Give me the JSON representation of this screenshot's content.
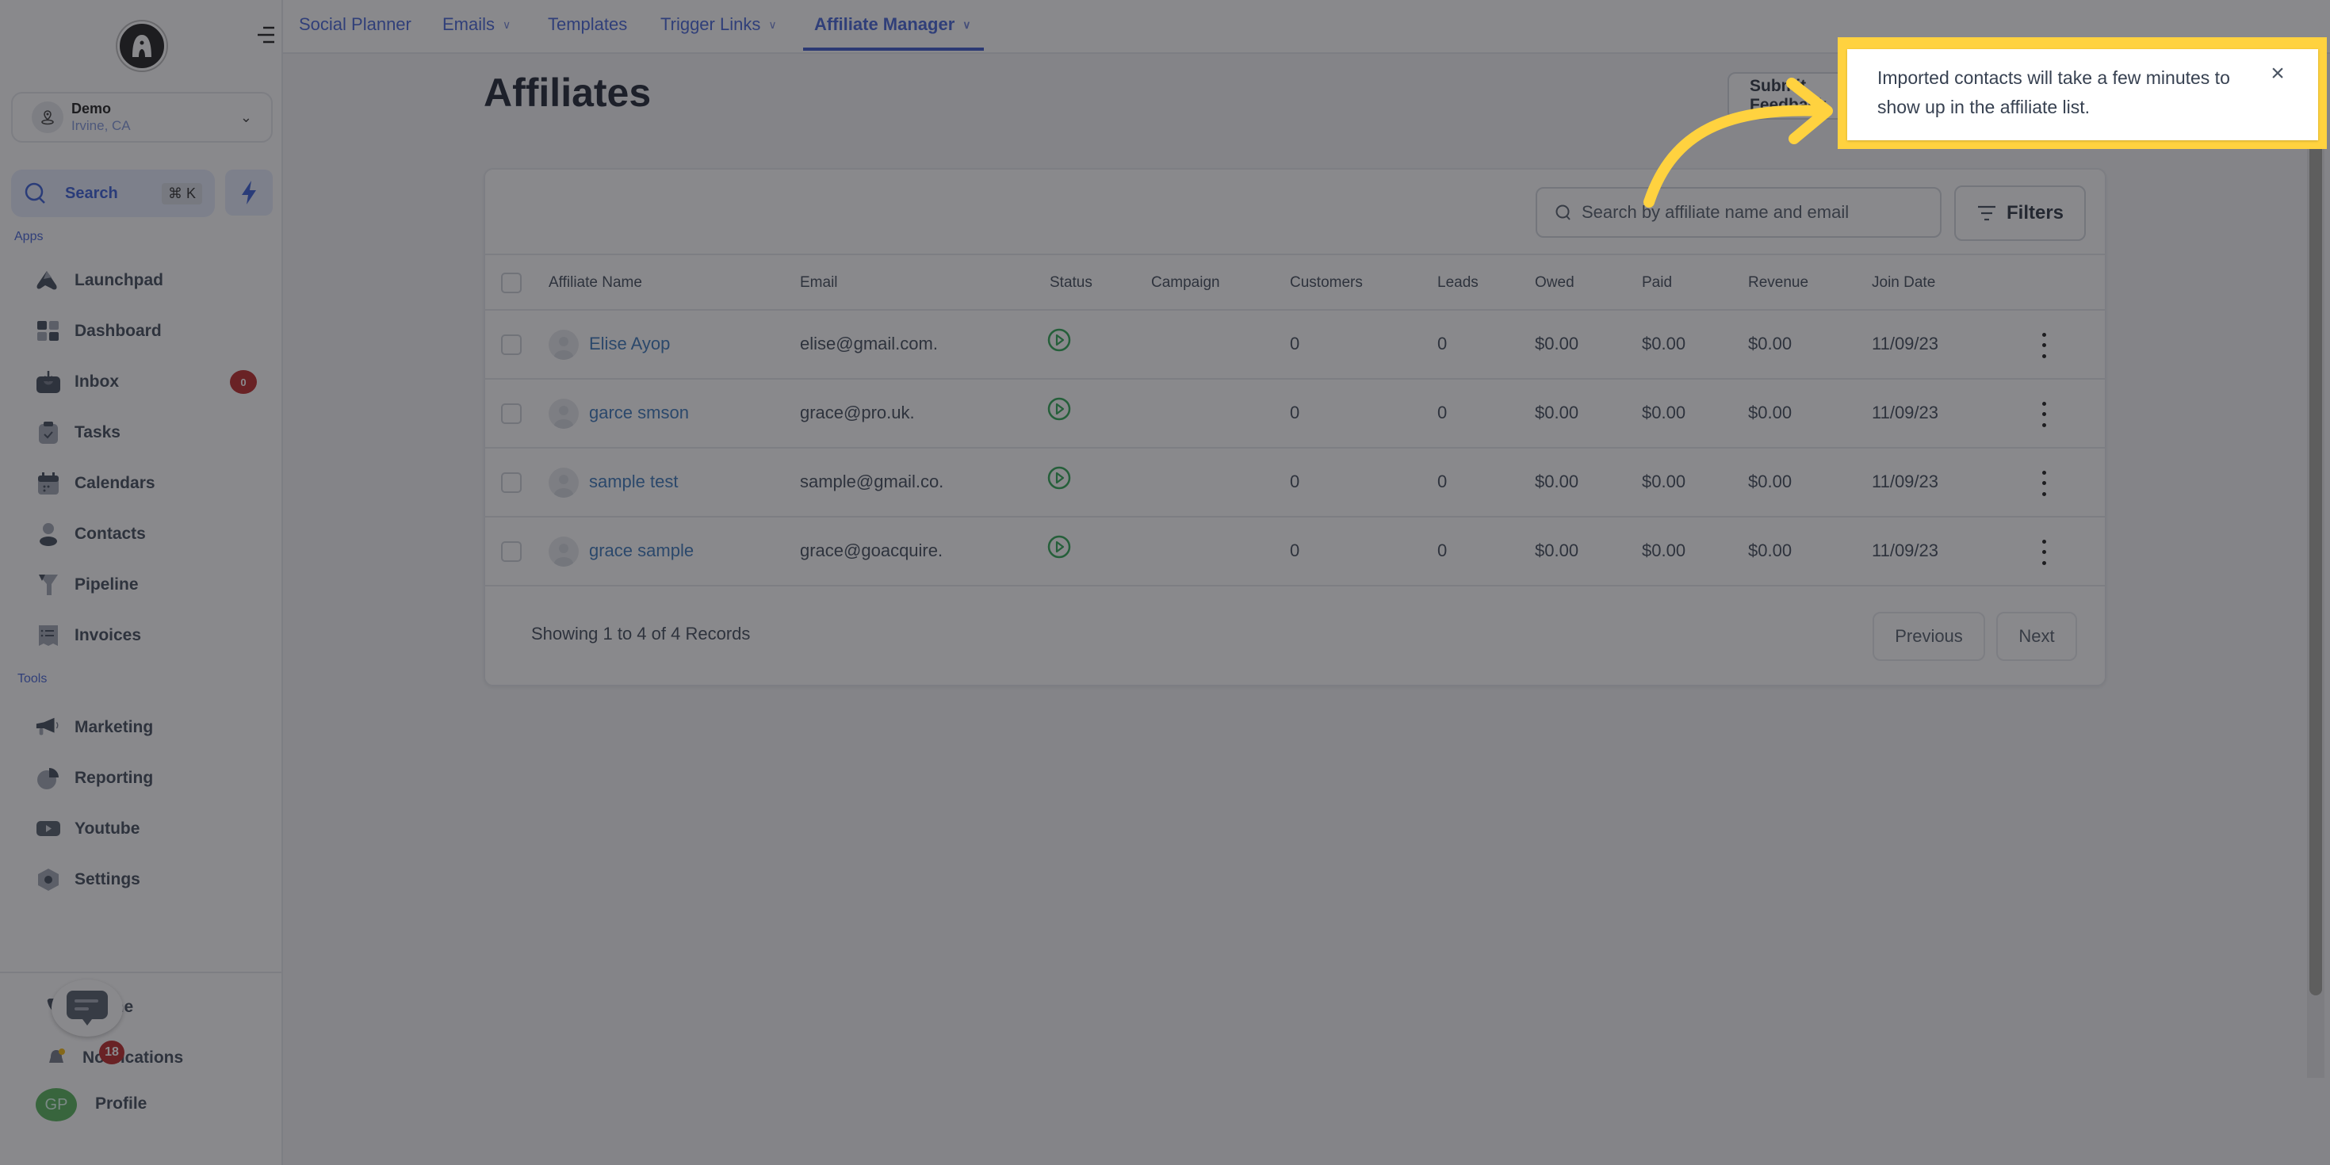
{
  "sidebar": {
    "account": {
      "name": "Demo",
      "location": "Irvine, CA"
    },
    "search": {
      "label": "Search",
      "shortcut": "⌘ K"
    },
    "apps_label": "Apps",
    "tools_label": "Tools",
    "apps": [
      {
        "label": "Launchpad",
        "icon": "launchpad-icon"
      },
      {
        "label": "Dashboard",
        "icon": "dashboard-icon"
      },
      {
        "label": "Inbox",
        "icon": "inbox-icon",
        "badge": "0"
      },
      {
        "label": "Tasks",
        "icon": "tasks-icon"
      },
      {
        "label": "Calendars",
        "icon": "calendar-icon"
      },
      {
        "label": "Contacts",
        "icon": "contacts-icon"
      },
      {
        "label": "Pipeline",
        "icon": "pipeline-icon"
      },
      {
        "label": "Invoices",
        "icon": "invoices-icon"
      }
    ],
    "tools": [
      {
        "label": "Marketing",
        "icon": "megaphone-icon"
      },
      {
        "label": "Reporting",
        "icon": "reporting-icon"
      },
      {
        "label": "Youtube",
        "icon": "youtube-icon"
      },
      {
        "label": "Settings",
        "icon": "settings-icon"
      }
    ],
    "bottom": [
      {
        "label": "Phone",
        "icon": "phone-icon"
      },
      {
        "label": "Notifications",
        "icon": "bell-icon"
      },
      {
        "label": "Profile",
        "icon": "avatar"
      }
    ],
    "profile_initials": "GP",
    "chat_badge": "18"
  },
  "topnav": {
    "tabs": [
      {
        "label": "Social Planner",
        "dropdown": false
      },
      {
        "label": "Emails",
        "dropdown": true
      },
      {
        "label": "Templates",
        "dropdown": false
      },
      {
        "label": "Trigger Links",
        "dropdown": true
      },
      {
        "label": "Affiliate Manager",
        "dropdown": true,
        "active": true
      }
    ]
  },
  "main": {
    "title": "Affiliates",
    "submit_feedback_label": "Submit Feedback",
    "search_placeholder": "Search by affiliate name and email",
    "filters_label": "Filters",
    "columns": [
      "Affiliate Name",
      "Email",
      "Status",
      "Campaign",
      "Customers",
      "Leads",
      "Owed",
      "Paid",
      "Revenue",
      "Join Date"
    ],
    "rows": [
      {
        "name": "Elise Ayop",
        "email": "elise@gmail.com.",
        "status": "active",
        "campaign": "",
        "customers": "0",
        "leads": "0",
        "owed": "$0.00",
        "paid": "$0.00",
        "revenue": "$0.00",
        "join_date": "11/09/23"
      },
      {
        "name": "garce smson",
        "email": "grace@pro.uk.",
        "status": "active",
        "campaign": "",
        "customers": "0",
        "leads": "0",
        "owed": "$0.00",
        "paid": "$0.00",
        "revenue": "$0.00",
        "join_date": "11/09/23"
      },
      {
        "name": "sample test",
        "email": "sample@gmail.co.",
        "status": "active",
        "campaign": "",
        "customers": "0",
        "leads": "0",
        "owed": "$0.00",
        "paid": "$0.00",
        "revenue": "$0.00",
        "join_date": "11/09/23"
      },
      {
        "name": "grace sample",
        "email": "grace@goacquire.",
        "status": "active",
        "campaign": "",
        "customers": "0",
        "leads": "0",
        "owed": "$0.00",
        "paid": "$0.00",
        "revenue": "$0.00",
        "join_date": "11/09/23"
      }
    ],
    "showing_text": "Showing 1 to 4 of 4 Records",
    "previous_label": "Previous",
    "next_label": "Next"
  },
  "toast": {
    "message": "Imported contacts will take a few minutes to show up in the affiliate list.",
    "close_label": "×"
  },
  "colors": {
    "accent": "#3b5bd6",
    "link": "#2f6fb6",
    "status_active": "#22a34a",
    "badge": "#b91c1c",
    "highlight": "#ffd23f"
  }
}
